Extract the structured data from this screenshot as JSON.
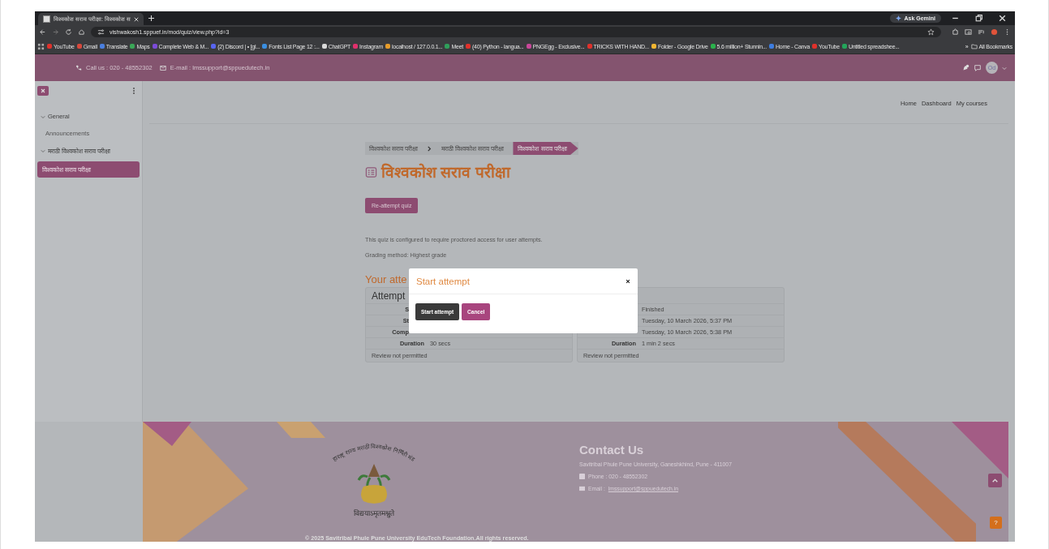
{
  "browser": {
    "tabs": [
      {
        "title": "विश्वकोश सराव परीक्षा: विश्वकोश स",
        "selected": true
      }
    ],
    "gemini_button": "Ask Gemini",
    "url": "vishwakosh1.sppuef.in/mod/quiz/view.php?id=3",
    "bookmarks": [
      {
        "label": "YouTube",
        "color": "#e0312b"
      },
      {
        "label": "Gmail",
        "color": "#d8483c"
      },
      {
        "label": "Translate",
        "color": "#4a7fe0"
      },
      {
        "label": "Maps",
        "color": "#3aa757"
      },
      {
        "label": "Complete Web & M...",
        "color": "#7b4bd8"
      },
      {
        "label": "(2) Discord | • [gl...",
        "color": "#5865f2"
      },
      {
        "label": "Fonts List Page 12 :...",
        "color": "#3a8ee0"
      },
      {
        "label": "ChatGPT",
        "color": "#d9d9d9"
      },
      {
        "label": "Instagram",
        "color": "#e1306c"
      },
      {
        "label": "localhost / 127.0.0.1...",
        "color": "#e69c2a"
      },
      {
        "label": "Meet",
        "color": "#2f9e5a"
      },
      {
        "label": "(40) Python - langua...",
        "color": "#e0312b"
      },
      {
        "label": "PNGEgg - Exclusive...",
        "color": "#c9479a"
      },
      {
        "label": "TRICKS WITH HAND...",
        "color": "#e0312b"
      },
      {
        "label": "Folder - Google Drive",
        "color": "#f2b632"
      },
      {
        "label": "5.6 million+ Stunnin...",
        "color": "#2bb24c"
      },
      {
        "label": "Home - Canva",
        "color": "#3d7de0"
      },
      {
        "label": "YouTube",
        "color": "#e0312b"
      },
      {
        "label": "Untitled spreadshee...",
        "color": "#23a55a"
      }
    ],
    "more_bookmarks": "»",
    "all_bookmarks": "All Bookmarks"
  },
  "header": {
    "phone": "Call us : 020 - 48552302",
    "email": "E-mail : lmssupport@sppuedutech.in",
    "avatar": "Od"
  },
  "sidebar": {
    "items": [
      {
        "label": "General",
        "expanded": true,
        "selected": false,
        "children": [
          {
            "label": "Announcements",
            "selected": false
          }
        ]
      },
      {
        "label": "मराठी विश्वकोश सराव परीक्षा",
        "expanded": true,
        "selected": false,
        "children": [
          {
            "label": "विश्वकोश सराव परीक्षा",
            "selected": true
          }
        ]
      }
    ]
  },
  "nav": [
    "Home",
    "Dashboard",
    "My courses"
  ],
  "breadcrumb": [
    {
      "label": "विश्वकोश सराव परीक्षा",
      "selected": false
    },
    {
      "label": "मराठी विश्वकोश सराव परीक्षा",
      "selected": false
    },
    {
      "label": "विश्वकोश सराव परीक्षा",
      "selected": true
    }
  ],
  "title": "विश्वकोश सराव परीक्षा",
  "reattempt_button": "Re-attempt quiz",
  "info": [
    "This quiz is configured to require proctored access for user attempts.",
    "Grading method: Highest grade"
  ],
  "attempts_heading": "Your atte",
  "attempts": [
    {
      "heading": "Attempt",
      "rows": [
        {
          "label": "S"
        },
        {
          "label": "St"
        },
        {
          "label": "Comp"
        },
        {
          "label": "Duration",
          "value": "30 secs"
        }
      ],
      "footer": "Review not permitted"
    },
    {
      "rows": [
        {
          "value": "Finished"
        },
        {
          "value": "Tuesday, 10 March 2026, 5:37 PM"
        },
        {
          "value": "Tuesday, 10 March 2026, 5:38 PM"
        },
        {
          "label": "Duration",
          "value": "1 min 2 secs"
        }
      ],
      "footer": "Review not permitted"
    }
  ],
  "modal": {
    "title": "Start attempt",
    "buttons": [
      {
        "label": "Start attempt",
        "kind": "primary"
      },
      {
        "label": "Cancel",
        "kind": "secondary"
      }
    ]
  },
  "footer": {
    "emblem_text": "महाराष्ट्र राज्य मराठी विश्वकोश निर्मिती मंडळ",
    "motto": "विद्ययाऽमृतमश्नुते",
    "contact_heading": "Contact Us",
    "address": "Savitribai Phule Pune University, Ganeshkhind, Pune - 411007",
    "phone": "Phone : 020 - 48552302",
    "email_label": "Email :",
    "email": "lmssupport@sppuedutech.in",
    "help": "?",
    "copyright": "© 2025 Savitribai Phule Pune University EduTech Foundation.All rights reserved."
  }
}
